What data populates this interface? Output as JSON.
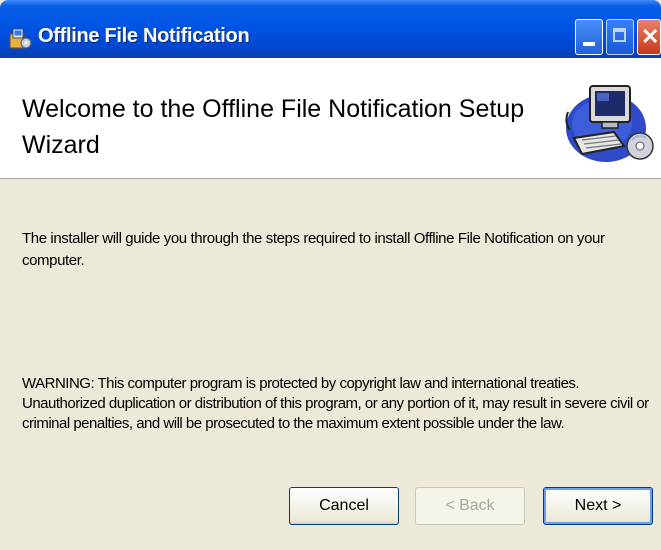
{
  "window": {
    "title": "Offline File Notification"
  },
  "header": {
    "title": "Welcome to the Offline File Notification Setup Wizard"
  },
  "body": {
    "description": "The installer will guide you through the steps required to install Offline File Notification on your computer.",
    "warning": "WARNING: This computer program is protected by copyright law and international treaties. Unauthorized duplication or distribution of this program, or any portion of it, may result in severe civil or criminal penalties, and will be prosecuted to the maximum extent possible under the law."
  },
  "buttons": {
    "cancel": "Cancel",
    "back": "< Back",
    "next": "Next >"
  },
  "icons": {
    "app": "installer-icon",
    "header": "computer-setup-icon"
  },
  "colors": {
    "titlebar": "#0054e3",
    "dialog_bg": "#ece9d8",
    "header_bg": "#ffffff",
    "close_button": "#c6391a"
  }
}
